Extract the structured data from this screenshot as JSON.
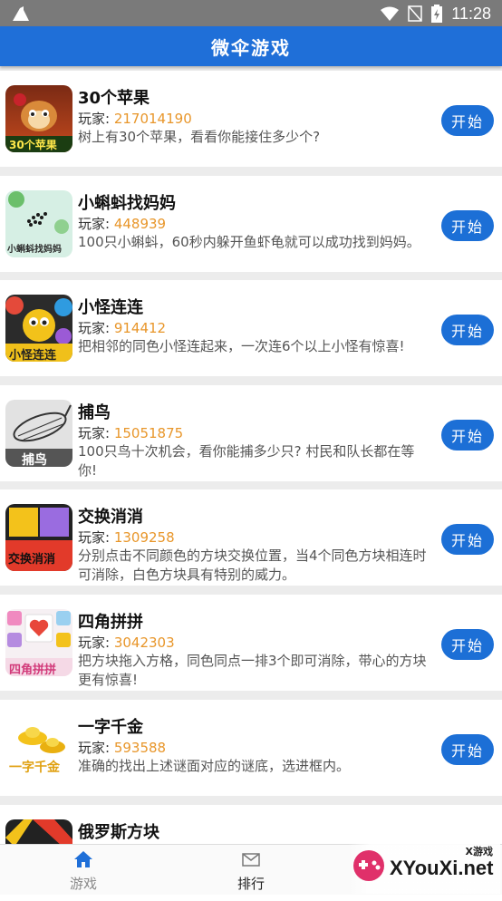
{
  "status_bar": {
    "time": "11:28"
  },
  "app_bar": {
    "title": "微伞游戏"
  },
  "players_label": "玩家:",
  "start_label": "开始",
  "games": [
    {
      "title": "30个苹果",
      "players": "217014190",
      "description": "树上有30个苹果，看看你能接住多少个?",
      "thumb_text": "30个苹果"
    },
    {
      "title": "小蝌蚪找妈妈",
      "players": "448939",
      "description": "100只小蝌蚪，60秒内躲开鱼虾龟就可以成功找到妈妈。",
      "thumb_text": "小蝌蚪找妈妈"
    },
    {
      "title": "小怪连连",
      "players": "914412",
      "description": "把相邻的同色小怪连起来，一次连6个以上小怪有惊喜!",
      "thumb_text": "小怪连连"
    },
    {
      "title": "捕鸟",
      "players": "15051875",
      "description": "100只鸟十次机会，看你能捕多少只? 村民和队长都在等你!",
      "thumb_text": "捕鸟"
    },
    {
      "title": "交换消消",
      "players": "1309258",
      "description": "分别点击不同颜色的方块交换位置，当4个同色方块相连时可消除，白色方块具有特别的威力。",
      "thumb_text": "交换消消"
    },
    {
      "title": "四角拼拼",
      "players": "3042303",
      "description": "把方块拖入方格，同色同点一排3个即可消除，带心的方块更有惊喜!",
      "thumb_text": "四角拼拼"
    },
    {
      "title": "一字千金",
      "players": "593588",
      "description": "准确的找出上述谜面对应的谜底，选进框内。",
      "thumb_text": "一字千金"
    },
    {
      "title": "俄罗斯方块",
      "players": "",
      "description": "",
      "thumb_text": ""
    }
  ],
  "tabs": [
    {
      "label": "游戏",
      "icon": "home-icon",
      "active": true
    },
    {
      "label": "排行",
      "icon": "mail-icon",
      "active": false
    }
  ],
  "watermark": {
    "small": "X游戏",
    "big": "XYouXi.net"
  },
  "colors": {
    "primary": "#1f6fd8",
    "players_number": "#e8962a",
    "status_bar": "#7a7a7a"
  }
}
